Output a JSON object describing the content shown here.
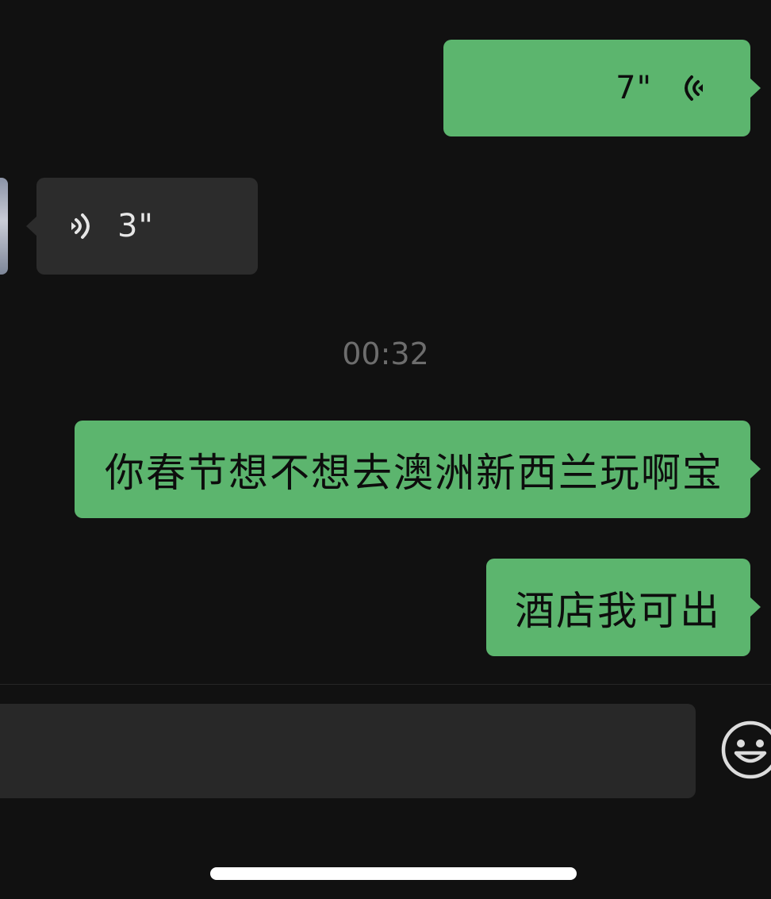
{
  "conversation": {
    "messages": [
      {
        "id": "voice-sent",
        "kind": "voice",
        "direction": "sent",
        "duration": "7\""
      },
      {
        "id": "voice-received",
        "kind": "voice",
        "direction": "received",
        "duration": "3\""
      },
      {
        "id": "text-msg-1",
        "kind": "text",
        "direction": "sent",
        "text": "你春节想不想去澳洲新西兰玩啊宝"
      },
      {
        "id": "text-msg-2",
        "kind": "text",
        "direction": "sent",
        "text": "酒店我可出"
      }
    ],
    "timestamp": "00:32"
  },
  "input": {
    "value": "",
    "placeholder": ""
  },
  "icons": {
    "voice_sent": "voice-wave-icon",
    "voice_received": "voice-wave-icon",
    "emoji": "smiley-face-icon"
  },
  "colors": {
    "background": "#111111",
    "sent_bubble": "#5cb56e",
    "received_bubble": "#2c2c2c",
    "timestamp_text": "#6d6d6d",
    "input_field": "#282828"
  }
}
